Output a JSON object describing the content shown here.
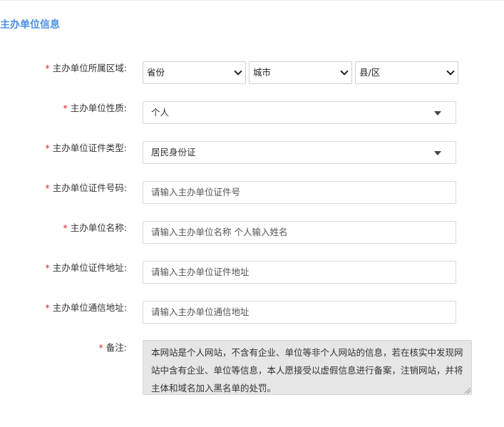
{
  "section": {
    "title": "主办单位信息"
  },
  "fields": {
    "region": {
      "label": "主办单位所属区域:",
      "province": "省份",
      "city": "城市",
      "county": "县/区"
    },
    "nature": {
      "label": "主办单位性质:",
      "value": "个人"
    },
    "cert_type": {
      "label": "主办单位证件类型:",
      "value": "居民身份证"
    },
    "cert_number": {
      "label": "主办单位证件号码:",
      "placeholder": "请输入主办单位证件号"
    },
    "name": {
      "label": "主办单位名称:",
      "placeholder": "请输入主办单位名称 个人输入姓名"
    },
    "cert_address": {
      "label": "主办单位证件地址:",
      "placeholder": "请输入主办单位证件地址"
    },
    "mail_address": {
      "label": "主办单位通信地址:",
      "placeholder": "请输入主办单位通信地址"
    },
    "remark": {
      "label": "备注:",
      "text": "本网站是个人网站，不含有企业、单位等非个人网站的信息，若在核实中发现网站中含有企业、单位等信息，本人愿接受以虚假信息进行备案，注销网站，并将主体和域名加入黑名单的处罚。"
    }
  },
  "required_mark": "*"
}
